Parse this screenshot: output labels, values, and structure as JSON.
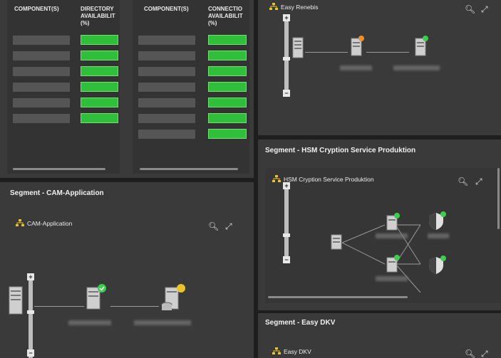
{
  "panel_directory": {
    "col1_header": "COMPONENT(S)",
    "col2_header": "DIRECTORY AVAILABILITY (%)",
    "col2_header_l1": "DIRECTORY",
    "col2_header_l2": "AVAILABILIT",
    "col2_header_l3": "(%)"
  },
  "panel_connection": {
    "col1_header": "COMPONENT(S)",
    "col2_header_l1": "CONNECTIO",
    "col2_header_l2": "AVAILABILIT",
    "col2_header_l3": "(%)"
  },
  "easy_renebis": {
    "label": "Easy Renebis"
  },
  "segment_hsm": {
    "title": "Segment - HSM Cryption Service Produktion",
    "inner_label": "HSM Cryption Service Produktion"
  },
  "segment_cam": {
    "title": "Segment - CAM-Application",
    "inner_label": "CAM-Application"
  },
  "segment_dkv": {
    "title": "Segment - Easy DKV",
    "inner_label": "Easy DKV"
  },
  "zoom": {
    "plus": "+",
    "minus": "−"
  },
  "icons": {
    "search": "search-icon",
    "expand": "expand-icon",
    "network": "network-icon"
  },
  "colors": {
    "bg": "#3a3a3a",
    "green": "#2fbf3b",
    "badge_green": "#3ccf4e",
    "badge_yellow": "#e8c32a",
    "badge_orange": "#f0902a"
  }
}
